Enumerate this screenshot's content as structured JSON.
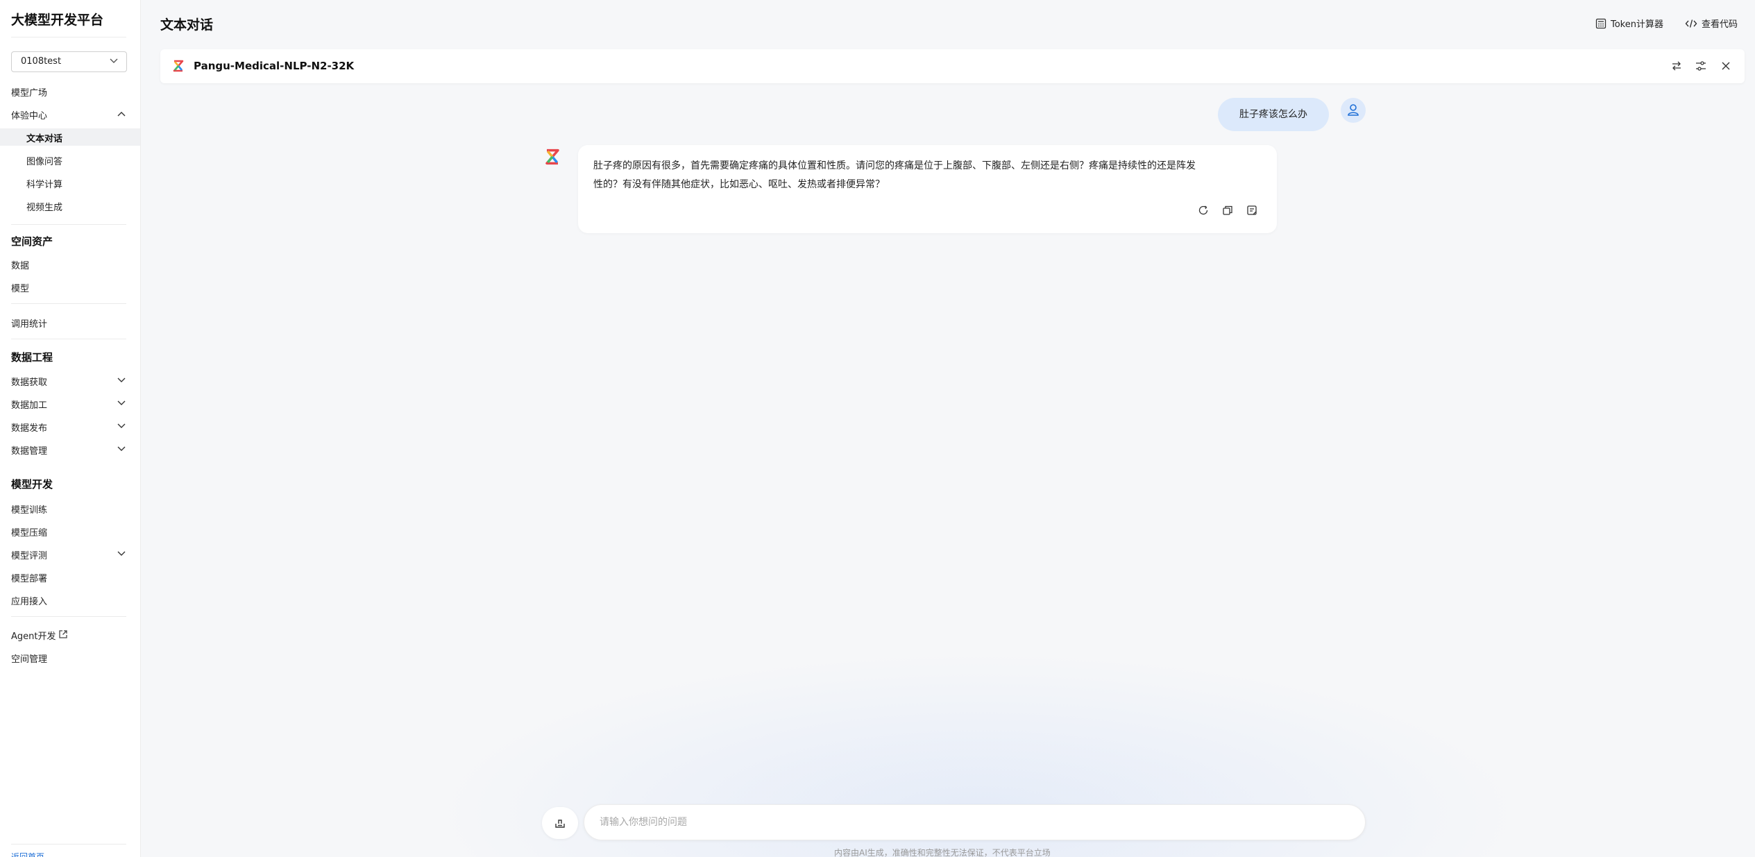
{
  "sidebar": {
    "brand": "大模型开发平台",
    "workspace": "0108test",
    "items": {
      "model_plaza": "模型广场",
      "experience_center": "体验中心",
      "text_chat": "文本对话",
      "image_qa": "图像问答",
      "sci_compute": "科学计算",
      "video_gen": "视频生成",
      "space_assets": "空间资产",
      "data": "数据",
      "model": "模型",
      "usage_stats": "调用统计",
      "data_engineering": "数据工程",
      "data_acquisition": "数据获取",
      "data_processing": "数据加工",
      "data_publish": "数据发布",
      "data_management": "数据管理",
      "model_dev": "模型开发",
      "model_training": "模型训练",
      "model_compression": "模型压缩",
      "model_eval": "模型评测",
      "model_deploy": "模型部署",
      "app_access": "应用接入",
      "agent_dev": "Agent开发",
      "space_management": "空间管理"
    },
    "bottom_link": "返回首页"
  },
  "header": {
    "title": "文本对话",
    "token_calc": "Token计算器",
    "view_code": "查看代码"
  },
  "model_bar": {
    "model_name": "Pangu-Medical-NLP-N2-32K"
  },
  "chat": {
    "user_message": "肚子疼该怎么办",
    "bot_line1": "肚子疼的原因有很多，首先需要确定疼痛的具体位置和性质。请问您的疼痛是位于上腹部、下腹部、左侧还是右侧？疼痛是持续性的还是阵发",
    "bot_line2": "性的？有没有伴随其他症状，比如恶心、呕吐、发热或者排便异常？"
  },
  "input": {
    "placeholder": "请输入你想问的问题",
    "disclaimer": "内容由AI生成，准确性和完整性无法保证，不代表平台立场"
  },
  "colors": {
    "accent": "#1f6fd6",
    "user_bubble": "#dce9fb"
  }
}
